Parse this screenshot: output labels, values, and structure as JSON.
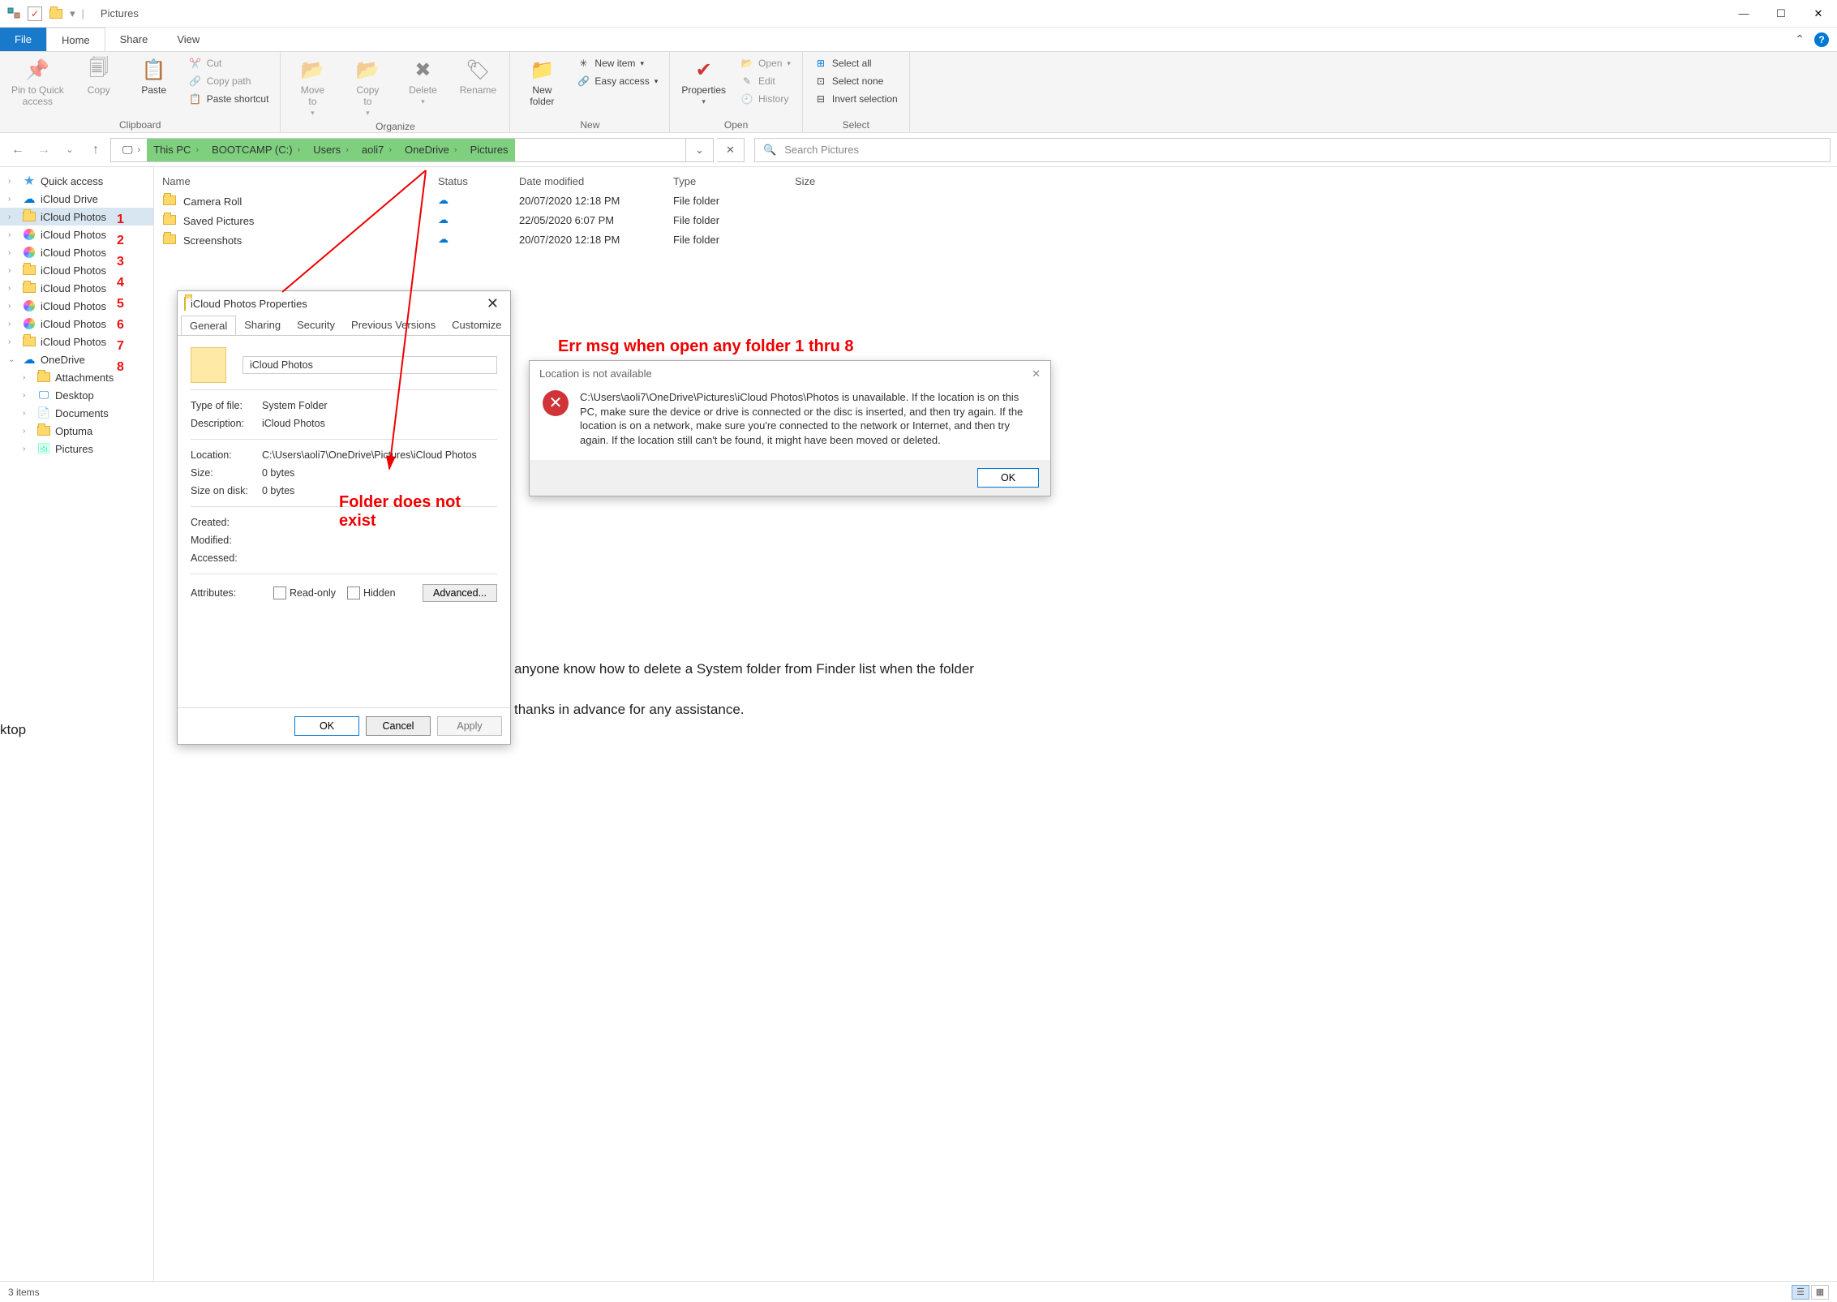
{
  "window": {
    "title": "Pictures"
  },
  "tabs": {
    "file": "File",
    "home": "Home",
    "share": "Share",
    "view": "View"
  },
  "ribbon": {
    "clipboard": {
      "label": "Clipboard",
      "pin": "Pin to Quick\naccess",
      "copy": "Copy",
      "paste": "Paste",
      "cut": "Cut",
      "copypath": "Copy path",
      "pasteshortcut": "Paste shortcut"
    },
    "organize": {
      "label": "Organize",
      "moveto": "Move\nto",
      "copyto": "Copy\nto",
      "delete": "Delete",
      "rename": "Rename"
    },
    "new": {
      "label": "New",
      "newfolder": "New\nfolder",
      "newitem": "New item",
      "easyaccess": "Easy access"
    },
    "open": {
      "label": "Open",
      "properties": "Properties",
      "open": "Open",
      "edit": "Edit",
      "history": "History"
    },
    "select": {
      "label": "Select",
      "selectall": "Select all",
      "selectnone": "Select none",
      "invert": "Invert selection"
    }
  },
  "breadcrumb": {
    "thispc": "This PC",
    "drive": "BOOTCAMP (C:)",
    "users": "Users",
    "user": "aoli7",
    "onedrive": "OneDrive",
    "pictures": "Pictures"
  },
  "search": {
    "placeholder": "Search Pictures"
  },
  "columns": {
    "name": "Name",
    "status": "Status",
    "date": "Date modified",
    "type": "Type",
    "size": "Size"
  },
  "rows": [
    {
      "name": "Camera Roll",
      "date": "20/07/2020 12:18 PM",
      "type": "File folder"
    },
    {
      "name": "Saved Pictures",
      "date": "22/05/2020 6:07 PM",
      "type": "File folder"
    },
    {
      "name": "Screenshots",
      "date": "20/07/2020 12:18 PM",
      "type": "File folder"
    }
  ],
  "tree": {
    "quick": "Quick access",
    "iclouddrive": "iCloud Drive",
    "icloudphotos": "iCloud Photos",
    "onedrive": "OneDrive",
    "attachments": "Attachments",
    "desktop": "Desktop",
    "documents": "Documents",
    "optuma": "Optuma",
    "pictures": "Pictures"
  },
  "annot_nums": [
    "1",
    "2",
    "3",
    "4",
    "5",
    "6",
    "7",
    "8"
  ],
  "props": {
    "title": "iCloud Photos Properties",
    "tabs": {
      "general": "General",
      "sharing": "Sharing",
      "security": "Security",
      "prev": "Previous Versions",
      "custom": "Customize"
    },
    "name": "iCloud Photos",
    "typefile_k": "Type of file:",
    "typefile_v": "System Folder",
    "desc_k": "Description:",
    "desc_v": "iCloud Photos",
    "location_k": "Location:",
    "location_v": "C:\\Users\\aoli7\\OneDrive\\Pictures\\iCloud Photos",
    "size_k": "Size:",
    "size_v": "0 bytes",
    "sizeondisk_k": "Size on disk:",
    "sizeondisk_v": "0 bytes",
    "created_k": "Created:",
    "modified_k": "Modified:",
    "accessed_k": "Accessed:",
    "attrs_k": "Attributes:",
    "readonly": "Read-only",
    "hidden": "Hidden",
    "advanced": "Advanced...",
    "ok": "OK",
    "cancel": "Cancel",
    "apply": "Apply"
  },
  "annotations": {
    "err_heading": "Err msg when open any folder 1 thru 8",
    "folder_not_exist": "Folder does not\nexist"
  },
  "err": {
    "title": "Location is not available",
    "body": "C:\\Users\\aoli7\\OneDrive\\Pictures\\iCloud Photos\\Photos is unavailable. If the location is on this PC, make sure the device or drive is connected or the disc is inserted, and then try again. If the location is on a network, make sure you're connected to the network or Internet, and then try again. If the location still can't be found, it might have been moved or deleted.",
    "ok": "OK"
  },
  "status": {
    "items": "3 items"
  },
  "bg": {
    "line1": "anyone know how to delete a System folder from Finder list when the folder",
    "line2": "thanks in advance for any assistance.",
    "ktop": "ktop"
  }
}
